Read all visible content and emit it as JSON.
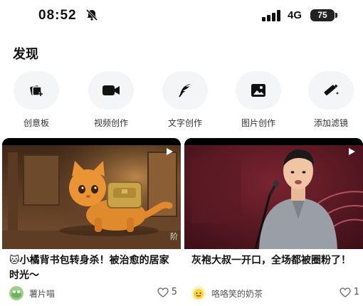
{
  "status": {
    "time": "08:52",
    "network": "4G",
    "battery": "75"
  },
  "section": {
    "title": "发现"
  },
  "tools": [
    {
      "label": "创意板",
      "icon": "cards-plus-icon"
    },
    {
      "label": "视频创作",
      "icon": "video-camera-icon"
    },
    {
      "label": "文字创作",
      "icon": "quill-icon"
    },
    {
      "label": "图片创作",
      "icon": "image-icon"
    },
    {
      "label": "添加滤镜",
      "icon": "magic-wand-icon"
    }
  ],
  "cards": [
    {
      "title": "🐱小橘背书包转身杀！被治愈的居家时光～",
      "author": "薯片喵",
      "likes": "5",
      "thumb_tag": "阶"
    },
    {
      "title": "灰袍大叔一开口，全场都被圈粉了！",
      "author": "咯咯笑的奶茶",
      "likes": "1"
    }
  ],
  "colors": {
    "accent": "#222222",
    "circle_bg": "#f4f5f7"
  }
}
